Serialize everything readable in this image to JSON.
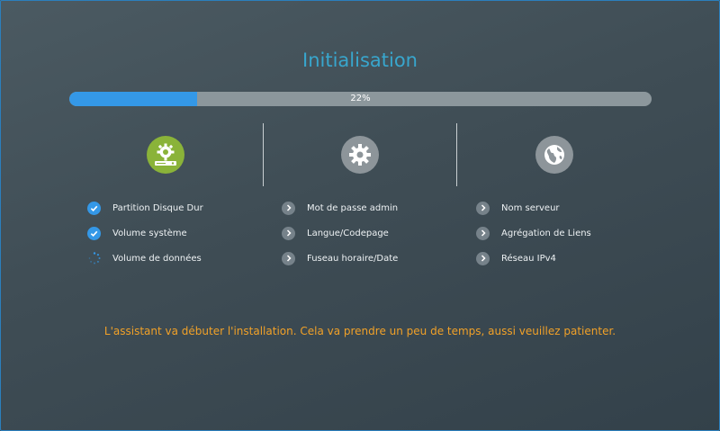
{
  "title": "Initialisation",
  "progress": {
    "percent": 22,
    "label": "22%"
  },
  "steps": [
    {
      "icon": "disk-gear-icon",
      "status": "active",
      "items": [
        {
          "label": "Partition Disque Dur",
          "state": "done"
        },
        {
          "label": "Volume système",
          "state": "done"
        },
        {
          "label": "Volume de données",
          "state": "in-progress"
        }
      ]
    },
    {
      "icon": "gear-icon",
      "status": "pending",
      "items": [
        {
          "label": "Mot de passe admin",
          "state": "pending"
        },
        {
          "label": "Langue/Codepage",
          "state": "pending"
        },
        {
          "label": "Fuseau horaire/Date",
          "state": "pending"
        }
      ]
    },
    {
      "icon": "globe-icon",
      "status": "pending",
      "items": [
        {
          "label": "Nom serveur",
          "state": "pending"
        },
        {
          "label": "Agrégation de Liens",
          "state": "pending"
        },
        {
          "label": "Réseau IPv4",
          "state": "pending"
        }
      ]
    }
  ],
  "message": "L'assistant va débuter l'installation. Cela va prendre un peu de temps, aussi veuillez patienter.",
  "colors": {
    "accent": "#38a6cd",
    "progress": "#3498e7",
    "active_step": "#8ab339",
    "pending_step": "#8d959a",
    "message": "#f1a128"
  }
}
